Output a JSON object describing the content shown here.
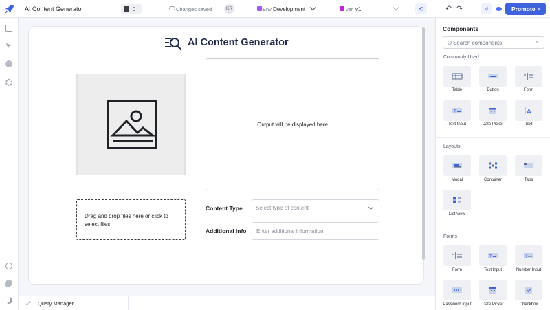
{
  "topbar": {
    "app_title": "AI Content Generator",
    "save_status": "Changes saved",
    "avatar_initials": "KR",
    "env_label": "Env",
    "env_value": "Development",
    "version_label": "ver",
    "version_value": "v1",
    "promote_label": "Promote",
    "promote_chevron": "»",
    "undo_glyph": "↶",
    "redo_glyph": "↷",
    "sync_glyph": "⟲",
    "share_glyph": "⋖"
  },
  "canvas": {
    "header_title": "AI Content Generator",
    "output_placeholder": "Output will be displayed here",
    "dropzone_text": "Drag and drop files here or click to select files",
    "content_type_label": "Content Type",
    "content_type_placeholder": "Select type of content",
    "additional_info_label": "Additional Info",
    "additional_info_placeholder": "Enter additional information"
  },
  "query_bar": {
    "label": "Query Manager",
    "expand_glyph": "⤢"
  },
  "components_panel": {
    "title": "Components",
    "search_placeholder": "Search components",
    "clear_glyph": "✕",
    "sections": [
      {
        "title": "Commonly Used",
        "items": [
          "Table",
          "Button",
          "Form",
          "Text Input",
          "Date Picker",
          "Text"
        ]
      },
      {
        "title": "Layouts",
        "items": [
          "Modal",
          "Container",
          "Tabs",
          "List View"
        ]
      },
      {
        "title": "Forms",
        "items": [
          "Form",
          "Text Input",
          "Number Input",
          "Password Input",
          "Date Picker",
          "Checkbox"
        ]
      }
    ]
  },
  "colors": {
    "accent": "#3e63dd",
    "env_badge": "#a855f7",
    "version_badge": "#c026d3",
    "title_text": "#1e2b4a"
  },
  "icons": {
    "logo": "rocket-icon",
    "rail": [
      "pages-icon",
      "inspect-icon",
      "debugger-icon",
      "settings-icon",
      "support-icon",
      "chat-icon",
      "theme-icon"
    ]
  }
}
